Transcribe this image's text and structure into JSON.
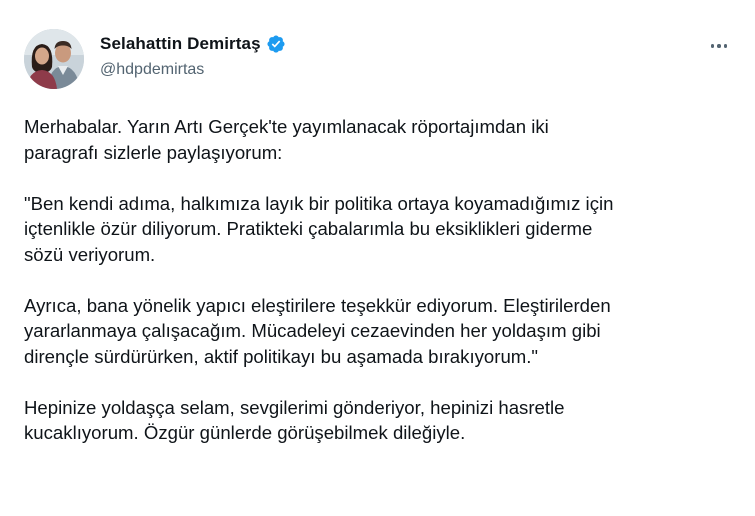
{
  "author": {
    "display_name": "Selahattin Demirtaş",
    "handle": "@hdpdemirtas",
    "verified": true,
    "avatar_icon": "profile-photo-two-people"
  },
  "menu": {
    "icon": "more-horizontal-icon"
  },
  "colors": {
    "text": "#0f1419",
    "secondary_text": "#536471",
    "verified_badge": "#1d9bf0"
  },
  "body": {
    "paragraphs": [
      "Merhabalar. Yarın Artı Gerçek'te yayımlanacak röportajımdan iki\nparagrafı sizlerle paylaşıyorum:",
      "\"Ben kendi adıma, halkımıza layık bir politika ortaya koyamadığımız için\niçtenlikle özür diliyorum. Pratikteki çabalarımla bu eksiklikleri giderme\nsözü veriyorum.",
      "Ayrıca, bana yönelik yapıcı eleştirilere teşekkür ediyorum. Eleştirilerden\nyararlanmaya çalışacağım. Mücadeleyi cezaevinden her yoldaşım gibi\ndirençle sürdürürken, aktif politikayı bu aşamada bırakıyorum.\"",
      "Hepinize yoldaşça selam, sevgilerimi gönderiyor, hepinizi hasretle\nkucaklıyorum. Özgür günlerde görüşebilmek dileğiyle."
    ]
  }
}
